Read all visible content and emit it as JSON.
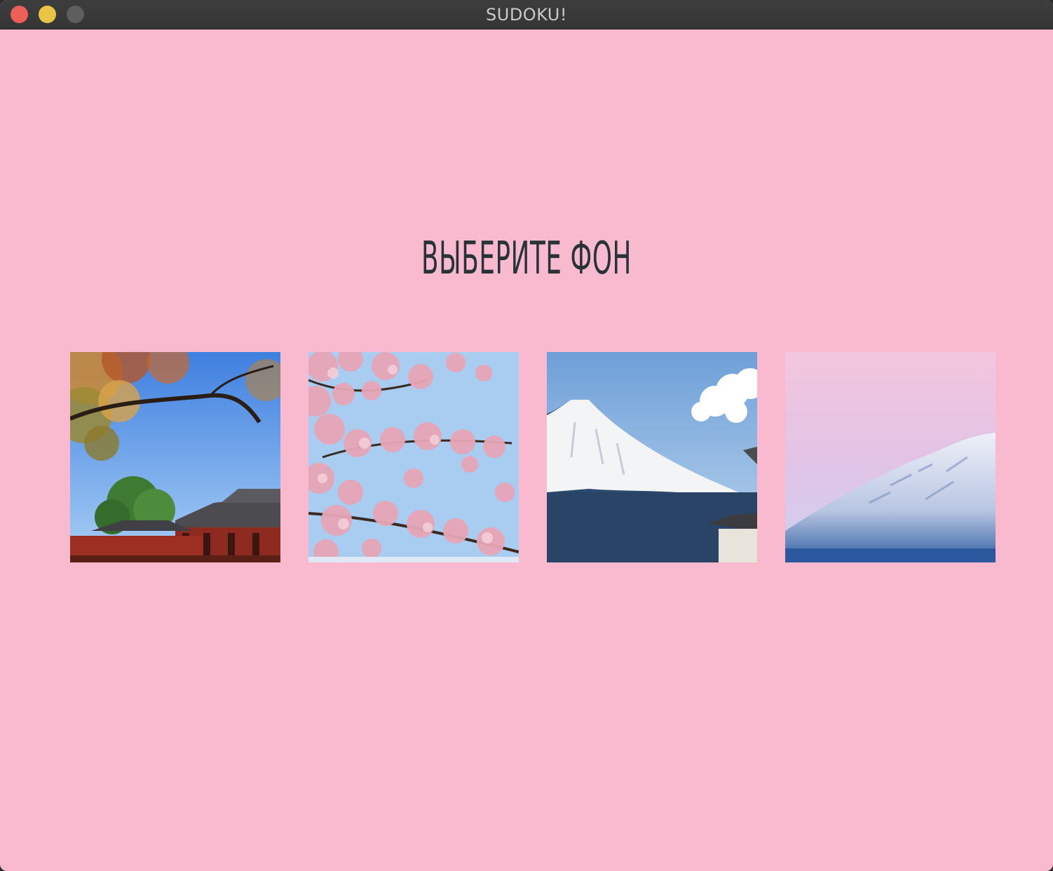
{
  "window": {
    "title": "SUDOKU!"
  },
  "screen": {
    "heading": "ВЫБЕРИТЕ ФОН"
  },
  "backgrounds": [
    {
      "icon": "temple-autumn-image"
    },
    {
      "icon": "cherry-blossom-image"
    },
    {
      "icon": "mount-fuji-image"
    },
    {
      "icon": "snowy-mountain-pink-sky-image"
    }
  ],
  "colors": {
    "background": "#f9b9cf",
    "heading": "#283338",
    "titlebar": "#3a3a3a"
  }
}
